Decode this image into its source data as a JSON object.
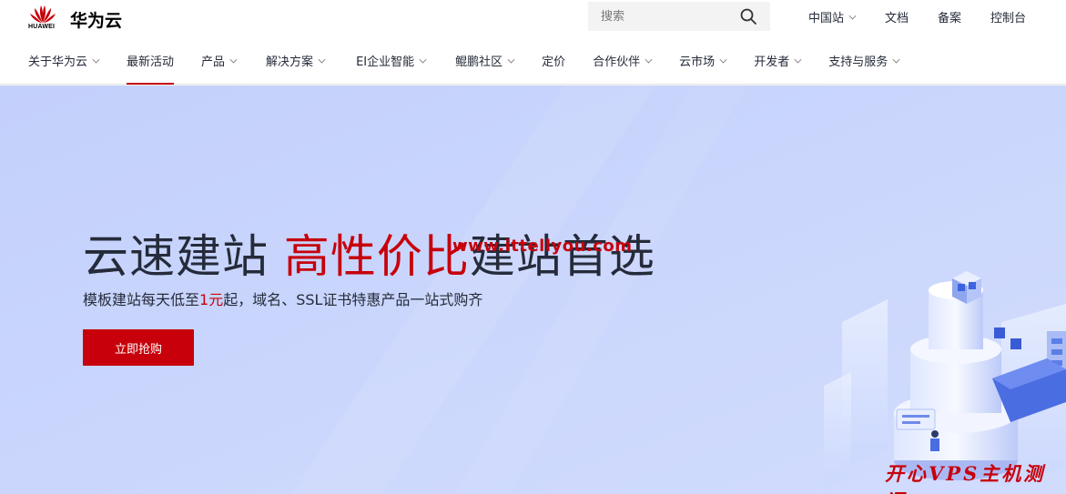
{
  "brand": {
    "logo_text": "HUAWEI",
    "name": "华为云",
    "accent": "#c7000b"
  },
  "search": {
    "placeholder": "搜索",
    "icon": "search-icon"
  },
  "top_links": [
    {
      "label": "中国站",
      "dropdown": true
    },
    {
      "label": "文档",
      "dropdown": false
    },
    {
      "label": "备案",
      "dropdown": false
    },
    {
      "label": "控制台",
      "dropdown": false
    }
  ],
  "nav": {
    "active": "最新活动",
    "items": [
      {
        "label": "关于华为云",
        "dropdown": true
      },
      {
        "label": "最新活动",
        "dropdown": false
      },
      {
        "label": "产品",
        "dropdown": true
      },
      {
        "label": "解决方案",
        "dropdown": true
      },
      {
        "label": "EI企业智能",
        "dropdown": true
      },
      {
        "label": "鲲鹏社区",
        "dropdown": true
      },
      {
        "label": "定价",
        "dropdown": false
      },
      {
        "label": "合作伙伴",
        "dropdown": true
      },
      {
        "label": "云市场",
        "dropdown": true
      },
      {
        "label": "开发者",
        "dropdown": true
      },
      {
        "label": "支持与服务",
        "dropdown": true
      }
    ]
  },
  "hero": {
    "title_pre": "云速建站 ",
    "title_highlight": "高性价比",
    "title_post": "建站首选",
    "subtitle_pre": "模板建站每天低至",
    "subtitle_highlight": "1元",
    "subtitle_post": "起，域名、SSL证书特惠产品一站式购齐",
    "button_label": "立即抢购",
    "background_color": "#c7d4fc"
  },
  "watermarks": {
    "center": "www.ittellyou.com",
    "corner": "开心VPS主机测评"
  }
}
